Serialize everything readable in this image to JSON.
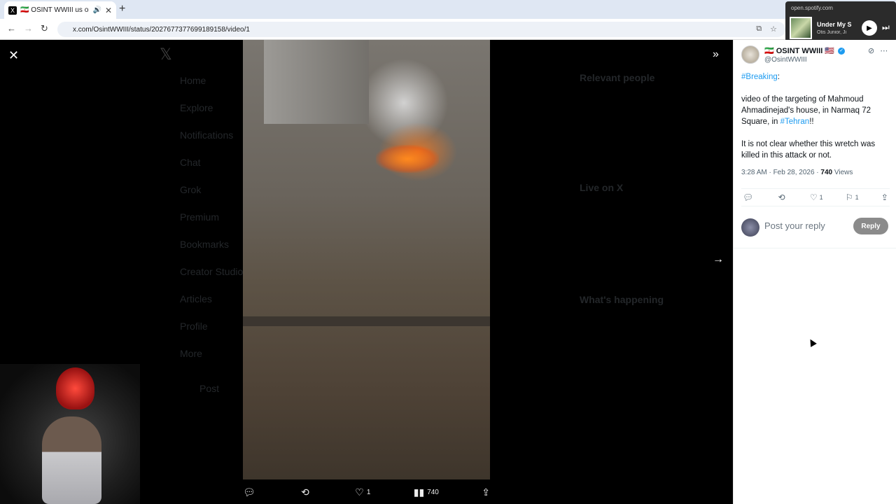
{
  "browser": {
    "tab_title": "🇮🇷 OSINT WWIII us on X: \"#",
    "tab_favicon": "X",
    "url": "x.com/OsintWWIII/status/2027677377699189158/video/1"
  },
  "spotify_popup": {
    "source": "open.spotify.com",
    "song": "Under My S",
    "artist": "Otis Junior, Ji"
  },
  "background_nav": [
    "Home",
    "Explore",
    "Notifications",
    "Chat",
    "Grok",
    "Premium",
    "Bookmarks",
    "Creator Studio",
    "Articles",
    "Profile",
    "More"
  ],
  "background_side": {
    "relevant_people": "Relevant people",
    "live_on_x": "Live on X",
    "whats_happening": "What's happening",
    "post_label": "Post"
  },
  "video_actions": {
    "replies": "",
    "reposts": "",
    "likes": "1",
    "views": "740"
  },
  "post": {
    "author_name": "🇮🇷 OSINT WWIII 🇺🇸",
    "handle": "@OsintWWIII",
    "hashtag_breaking": "#Breaking",
    "breaking_suffix": ":",
    "line2_pre": "video of the targeting of Mahmoud Ahmadinejad's house, in Narmaq 72 Square, in ",
    "hashtag_tehran": "#Tehran",
    "line2_suffix": "!!",
    "line3": "It is not clear whether this wretch was killed in this attack or not.",
    "timestamp": "3:28 AM · Feb 28, 2026 · ",
    "views_count": "740",
    "views_label": " Views",
    "stats": {
      "replies": "",
      "reposts": "",
      "likes": "1",
      "bookmarks": "1"
    },
    "reply_placeholder": "Post your reply",
    "reply_button": "Reply"
  }
}
